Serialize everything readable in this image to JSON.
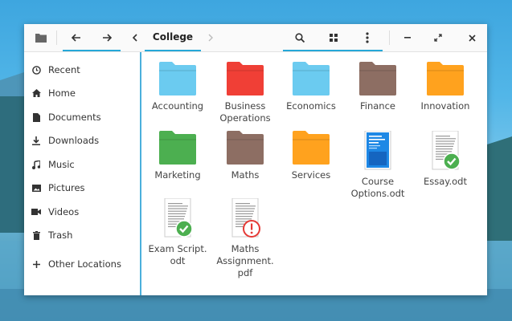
{
  "toolbar": {
    "location": "College"
  },
  "sidebar": {
    "items": [
      {
        "label": "Recent",
        "icon": "clock-icon"
      },
      {
        "label": "Home",
        "icon": "home-icon"
      },
      {
        "label": "Documents",
        "icon": "document-icon"
      },
      {
        "label": "Downloads",
        "icon": "download-icon"
      },
      {
        "label": "Music",
        "icon": "music-icon"
      },
      {
        "label": "Pictures",
        "icon": "picture-icon"
      },
      {
        "label": "Videos",
        "icon": "video-icon"
      },
      {
        "label": "Trash",
        "icon": "trash-icon"
      },
      {
        "label": "Other Locations",
        "icon": "plus-icon"
      }
    ]
  },
  "files": [
    {
      "label": "Accounting",
      "type": "folder",
      "color": "#6ccbf0"
    },
    {
      "label": "Business\nOperations",
      "type": "folder",
      "color": "#ef3f36"
    },
    {
      "label": "Economics",
      "type": "folder",
      "color": "#6ccbf0"
    },
    {
      "label": "Finance",
      "type": "folder",
      "color": "#8d6e63"
    },
    {
      "label": "Innovation",
      "type": "folder",
      "color": "#ffa21e"
    },
    {
      "label": "Marketing",
      "type": "folder",
      "color": "#4caf50"
    },
    {
      "label": "Maths",
      "type": "folder",
      "color": "#8d6e63"
    },
    {
      "label": "Services",
      "type": "folder",
      "color": "#ffa21e"
    },
    {
      "label": "Course\nOptions.odt",
      "type": "document-blue"
    },
    {
      "label": "Essay.odt",
      "type": "document-check"
    },
    {
      "label": "Exam Script.\nodt",
      "type": "document-check"
    },
    {
      "label": "Maths\nAssignment.\npdf",
      "type": "document-warning"
    }
  ],
  "colors": {
    "accent": "#26a8d8",
    "check": "#4caf50",
    "warning": "#e53935"
  }
}
